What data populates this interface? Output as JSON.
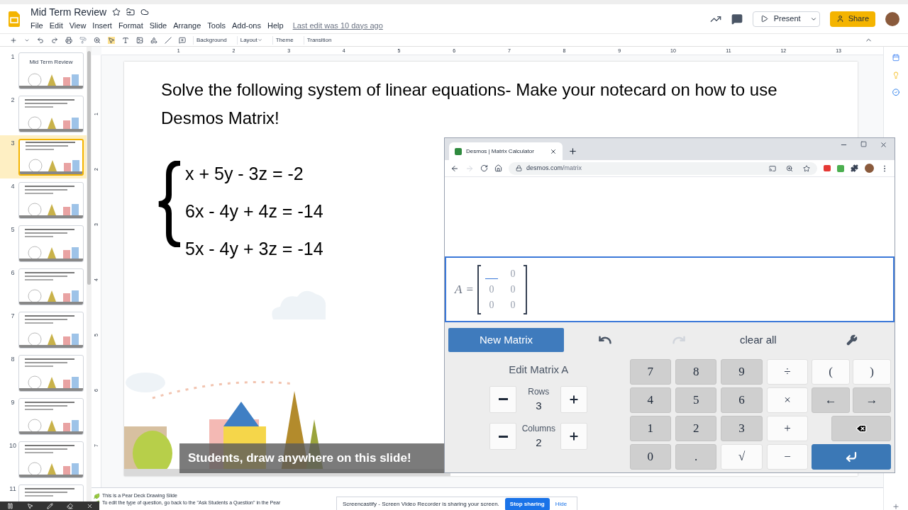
{
  "app": {
    "title": "Mid Term Review",
    "last_edit": "Last edit was 10 days ago",
    "present": "Present",
    "share": "Share"
  },
  "menu": [
    "File",
    "Edit",
    "View",
    "Insert",
    "Format",
    "Slide",
    "Arrange",
    "Tools",
    "Add-ons",
    "Help"
  ],
  "toolbar": [
    {
      "label": "Background",
      "caret": false
    },
    {
      "label": "Layout",
      "caret": true
    },
    {
      "label": "Theme",
      "caret": false
    },
    {
      "label": "Transition",
      "caret": false
    }
  ],
  "ruler": {
    "marks": [
      "1",
      "2",
      "3",
      "4",
      "5",
      "6",
      "7",
      "8",
      "9",
      "10",
      "11",
      "12",
      "13"
    ],
    "side_marks": [
      "1",
      "2",
      "3",
      "4",
      "5",
      "6",
      "7"
    ]
  },
  "filmstrip": [
    {
      "number": "1",
      "title": "Mid Term Review",
      "selected": false
    },
    {
      "number": "2",
      "selected": false
    },
    {
      "number": "3",
      "selected": true
    },
    {
      "number": "4",
      "selected": false
    },
    {
      "number": "5",
      "selected": false
    },
    {
      "number": "6",
      "selected": false
    },
    {
      "number": "7",
      "selected": false
    },
    {
      "number": "8",
      "selected": false
    },
    {
      "number": "9",
      "selected": false
    },
    {
      "number": "10",
      "selected": false
    },
    {
      "number": "11",
      "selected": false
    }
  ],
  "slide": {
    "heading": "Solve the following system of linear equations- Make your notecard on how to use Desmos Matrix!",
    "equations": [
      "x + 5y - 3z = -2",
      "6x - 4y + 4z = -14",
      "5x - 4y + 3z = -14"
    ],
    "banner": "Students, draw anywhere on this slide!"
  },
  "notes": [
    "This is a Pear Deck Drawing Slide",
    "To edit the type of question, go back to the \"Ask Students a Question\" in the Pear"
  ],
  "sharing": {
    "message": "Screencastify - Screen Video Recorder is sharing your screen.",
    "stop": "Stop sharing",
    "hide": "Hide"
  },
  "browser": {
    "tab_title": "Desmos | Matrix Calculator",
    "host": "desmos.com",
    "path": "/matrix"
  },
  "matrix": {
    "name": "A",
    "equals": "=",
    "cells": [
      {
        "kind": "cursor"
      },
      {
        "kind": "value",
        "placeholder": "0"
      },
      {
        "kind": "value",
        "placeholder": "0"
      },
      {
        "kind": "value",
        "placeholder": "0"
      },
      {
        "kind": "value",
        "placeholder": "0"
      },
      {
        "kind": "value",
        "placeholder": "0"
      }
    ]
  },
  "calculator": {
    "new_matrix": "New Matrix",
    "clear_all": "clear all",
    "edit_title": "Edit Matrix A",
    "redo_disabled": true,
    "steppers": [
      {
        "label": "Rows",
        "value": "3"
      },
      {
        "label": "Columns",
        "value": "2"
      }
    ],
    "keys": [
      {
        "label": "7",
        "kind": "num"
      },
      {
        "label": "8",
        "kind": "num"
      },
      {
        "label": "9",
        "kind": "num"
      },
      {
        "label": "÷",
        "kind": "op"
      },
      {
        "label": "4",
        "kind": "num"
      },
      {
        "label": "5",
        "kind": "num"
      },
      {
        "label": "6",
        "kind": "num"
      },
      {
        "label": "×",
        "kind": "op"
      },
      {
        "label": "1",
        "kind": "num"
      },
      {
        "label": "2",
        "kind": "num"
      },
      {
        "label": "3",
        "kind": "num"
      },
      {
        "label": "+",
        "kind": "op"
      },
      {
        "label": "0",
        "kind": "num"
      },
      {
        "label": ".",
        "kind": "num"
      },
      {
        "label": "√",
        "kind": "op"
      },
      {
        "label": "−",
        "kind": "op"
      }
    ],
    "side_keys": [
      {
        "label": "(",
        "kind": "op"
      },
      {
        "label": ")",
        "kind": "op"
      },
      {
        "label": "←",
        "kind": "num"
      },
      {
        "label": "→",
        "kind": "num"
      },
      {
        "kind": "backspace"
      },
      {
        "kind": "enter"
      }
    ]
  }
}
